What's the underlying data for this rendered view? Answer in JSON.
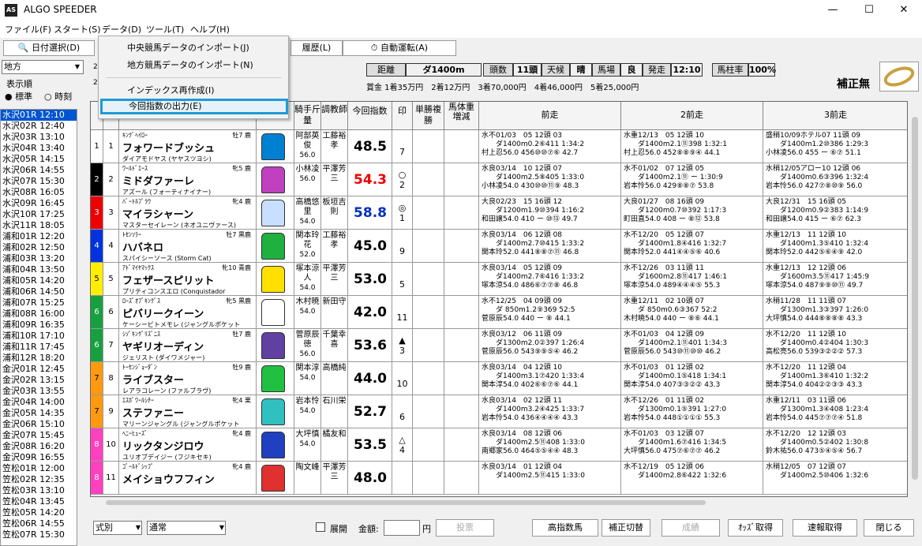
{
  "app": {
    "title": "ALGO SPEEDER",
    "logo": "AS"
  },
  "window": {
    "minimize": "—",
    "maximize": "☐",
    "close": "✕"
  },
  "menu": [
    "ファイル(F)",
    "スタート(S)",
    "データ(D)",
    "ツール(T)",
    "ヘルプ(H)"
  ],
  "toolbar": {
    "date_select": "日付選択(D)",
    "history": "履歴(L)",
    "auto_run": "自動運転(A)"
  },
  "dropdown": {
    "items": [
      "中央競馬データのインポート(J)",
      "地方競馬データのインポート(N)",
      "インデックス再作成(I)",
      "今回指数の出力(E)"
    ]
  },
  "left": {
    "venue": "地方",
    "sort_label": "表示順",
    "sort_standard": "● 標準",
    "sort_time": "○ 時刻"
  },
  "races": [
    "水沢01R 12:10",
    "水沢02R 12:40",
    "水沢03R 13:10",
    "水沢04R 13:40",
    "水沢05R 14:15",
    "水沢06R 14:55",
    "水沢07R 15:30",
    "水沢08R 16:05",
    "水沢09R 16:45",
    "水沢10R 17:25",
    "水沢11R 18:05",
    "浦和01R 12:20",
    "浦和02R 12:50",
    "浦和03R 13:20",
    "浦和04R 13:50",
    "浦和05R 14:20",
    "浦和06R 14:50",
    "浦和07R 15:25",
    "浦和08R 16:00",
    "浦和09R 16:35",
    "浦和10R 17:10",
    "浦和11R 17:45",
    "浦和12R 18:20",
    "金沢01R 12:45",
    "金沢02R 13:15",
    "金沢03R 13:55",
    "金沢04R 14:00",
    "金沢05R 14:35",
    "金沢06R 15:10",
    "金沢07R 15:45",
    "金沢08R 16:20",
    "金沢09R 16:55",
    "笠松01R 12:00",
    "笠松02R 12:35",
    "笠松03R 13:10",
    "笠松04R 13:45",
    "笠松05R 14:20",
    "笠松06R 14:55",
    "笠松07R 15:30"
  ],
  "race_info": {
    "dist_label": "距離",
    "dist": "ダ1400m",
    "heads_label": "頭数",
    "heads": "11頭",
    "weather_label": "天候",
    "weather": "晴",
    "track_label": "馬場",
    "track": "良",
    "post_label": "発走",
    "post": "12:10",
    "rate_label": "馬柱率",
    "rate": "100%",
    "prize": "賞金 1着35万円　2着12万円　3着70,000円　4着46,000円　5着25,000円",
    "correction": "補正無"
  },
  "headers": {
    "jockey": "騎手斤量",
    "trainer": "調教師",
    "index": "今回指数",
    "mark": "印",
    "odds": "単勝複勝",
    "weight": "馬体重増減",
    "p1": "前走",
    "p2": "2前走",
    "p3": "3前走"
  },
  "horses": [
    {
      "f": "1",
      "n": "1",
      "sire": "ｷﾝｸﾞﾍｲﾛｰ",
      "sex": "牡7 鹿",
      "name": "フォワードブッシュ",
      "dam": "ダイアモドヤス (ヤヤスツヨシ)",
      "j": "阿部英俊",
      "w": "56.0",
      "t": "工藤裕孝",
      "idx": "48.5",
      "ic": "#000",
      "mk": "",
      "pop": "7",
      "p": [
        "水不01/03　05 12頭 03",
        "ダ1400m0.2⑥411 1:34:2",
        "村上忍56.0 456⑩⑩⑦⑥ 42.7"
      ],
      "q": [
        "水重12/13　05 12頭 10",
        "ダ1400m2.1⑪398 1:32:1",
        "村上忍56.0 452⑧⑧⑨④ 44.1"
      ],
      "r": [
        "盛稍10/09ホテル07 11頭 09",
        "ダ1400m1.2⑩386 1:29:3",
        "小林凌56.0 455 ー ⑥⑦ 51.1"
      ]
    },
    {
      "f": "2",
      "n": "2",
      "sire": "ﾜｰﾙﾄﾞｴｰｽ",
      "sex": "牝5 鹿",
      "name": "ミドダファーレ",
      "dam": "アズール (フォーティナイナー)",
      "j": "小林凌",
      "w": "56.0",
      "t": "平澤芳三",
      "idx": "54.3",
      "ic": "#e00",
      "mk": "○",
      "pop": "2",
      "p": [
        "水良03/14　10 12頭 07",
        "ダ1400m2.5⑧405 1:33:0",
        "小林凌54.0 430⑩⑩⑪⑨ 48.3"
      ],
      "q": [
        "水不01/02　07 12頭 05",
        "ダ1400m2.1⑪ ー 1:30:9",
        "岩本怜56.0 429⑧⑧⑦ 53.8"
      ],
      "r": [
        "水稍12/05アロー10 12頭 06",
        "ダ1400m0.6③396 1:32:4",
        "岩本怜56.0 427⑦⑧⑩⑨ 56.0"
      ]
    },
    {
      "f": "3",
      "n": "3",
      "sire": "ﾊﾞｰﾄﾙﾌﾟﾗｳ",
      "sex": "牝4 鹿",
      "name": "マイラシャーン",
      "dam": "マスターセイレーン (ネオユニヴァース)",
      "j": "高橋悠里",
      "w": "54.0",
      "t": "板垣吉則",
      "idx": "58.8",
      "ic": "#0030c0",
      "mk": "◎",
      "pop": "1",
      "p": [
        "大良02/23　15 16頭 12",
        "ダ1200m1.9⑩394 1:16:2",
        "和田譲54.0 410 ー ⑩⑬ 49.7"
      ],
      "q": [
        "大良01/27　08 16頭 09",
        "ダ1200m0.7⑩392 1:17:3",
        "町田直54.0 408 ー ⑧⑫ 53.8"
      ],
      "r": [
        "大良12/31　15 16頭 05",
        "ダ1200m0.9②383 1:14:9",
        "和田譲54.0 415 ー ⑥⑦ 62.3"
      ]
    },
    {
      "f": "4",
      "n": "4",
      "sire": "ﾄｾﾝｿﾗｰ",
      "sex": "牡7 黒鹿",
      "name": "ハバネロ",
      "dam": "スパイシーソース (Storm Cat)",
      "j": "関本玲花",
      "w": "52.0",
      "t": "工藤裕孝",
      "idx": "45.0",
      "ic": "#000",
      "mk": "",
      "pop": "9",
      "p": [
        "水良03/14　06 12頭 08",
        "ダ1400m2.7⑩415 1:33:2",
        "関本玲52.0 441⑧⑧⑦⑪ 46.8"
      ],
      "q": [
        "水不12/20　05 12頭 07",
        "ダ1400m1.8④416 1:32:7",
        "関本玲52.0 441④④⑤⑥ 40.6"
      ],
      "r": [
        "水重12/13　11 12頭 10",
        "ダ1400m1.3⑤410 1:32:4",
        "関本玲52.0 442⑤⑥④⑨ 42.0"
      ]
    },
    {
      "f": "5",
      "n": "5",
      "sire": "ｱﾄﾞﾏｲﾔﾏｯｸｽ",
      "sex": "牝10 青鹿",
      "name": "フェザースピリット",
      "dam": "プリティコンスエロ (Conquistador",
      "j": "塚本涼人",
      "w": "54.0",
      "t": "平澤芳三",
      "idx": "53.0",
      "ic": "#000",
      "mk": "",
      "pop": "5",
      "p": [
        "水良03/14　05 12頭 09",
        "ダ1400m2.7⑥416 1:33:2",
        "塚本涼54.0 486⑥⑦⑦⑧ 46.8"
      ],
      "q": [
        "水不12/26　03 11頭 11",
        "ダ1600m2.8⑪417 1:46:1",
        "塚本涼54.0 489④④④⑤ 55.3"
      ],
      "r": [
        "水重12/13　12 12頭 06",
        "ダ1600m3.5⑪417 1:45:9",
        "塚本涼54.0 487⑨⑨⑩⑪ 49.7"
      ]
    },
    {
      "f": "6",
      "n": "6",
      "sire": "ﾛｰｽﾞｵﾌﾞｷﾝｸﾞｽ",
      "sex": "牝5 黒鹿",
      "name": "ピバリークイーン",
      "dam": "ケーシービトメモレ (ジャングルポケット",
      "j": "木村暁",
      "w": "54.0",
      "t": "新田守",
      "idx": "42.0",
      "ic": "#000",
      "mk": "",
      "pop": "11",
      "p": [
        "水不12/25　04 09頭 09",
        "ダ 850m1.2⑨369 52:5",
        "菅原辰54.0 440 ー ⑧ 44.1"
      ],
      "q": [
        "水重12/11　02 10頭 07",
        "ダ 850m0.6③367 52:2",
        "木村暁54.0 440 ー ⑧⑥ 44.1"
      ],
      "r": [
        "水稍11/28　11 11頭 07",
        "ダ1300m1.3③397 1:26:0",
        "大坪慎54.0 444⑧⑧⑧⑧ 43.3"
      ]
    },
    {
      "f": "6",
      "n": "7",
      "sire": "ｼｿﾞｷﾝｸﾞﾘｽﾞﾆｽ",
      "sex": "牡7 鹿",
      "name": "ヤギリオーディン",
      "dam": "ジェリスト (ダイワメジャー)",
      "j": "菅原辰徳",
      "w": "56.0",
      "t": "千葉幸喜",
      "idx": "53.6",
      "ic": "#000",
      "mk": "▲",
      "pop": "3",
      "p": [
        "水良03/12　06 11頭 09",
        "ダ1300m2.0②397 1:26:4",
        "菅原辰56.0 543⑨⑨⑤④ 46.2"
      ],
      "q": [
        "水不01/03　04 12頭 09",
        "ダ1400m2.1⑪401 1:34:3",
        "菅原辰56.0 543⑩⑪⑩⑩ 46.2"
      ],
      "r": [
        "水不12/20　11 12頭 10",
        "ダ1400m0.4②404 1:30:3",
        "高松亮56.0 539③②②② 57.3"
      ]
    },
    {
      "f": "7",
      "n": "8",
      "sire": "ﾄｰｾﾝｼﾞｮｰﾀﾞﾝ",
      "sex": "牡9 鹿",
      "name": "ライブスター",
      "dam": "レアラコレーン (ファルブラヴ)",
      "j": "関本淳",
      "w": "54.0",
      "t": "高橋純",
      "idx": "44.0",
      "ic": "#000",
      "mk": "",
      "pop": "10",
      "p": [
        "水良03/14　04 12頭 10",
        "ダ1400m3.1⑦420 1:33:4",
        "関本淳54.0 402⑥⑥⑦⑥ 44.1"
      ],
      "q": [
        "水不01/03　01 12頭 02",
        "ダ1400m0.1⑤418 1:34:1",
        "関本淳54.0 407③③②② 43.3"
      ],
      "r": [
        "水不12/20　11 12頭 04",
        "ダ1400m1.3⑥410 1:32:2",
        "関本淳54.0 404②②③③ 43.3"
      ]
    },
    {
      "f": "7",
      "n": "9",
      "sire": "ｴｽﾎﾟﾜｰﾙｼﾁｰ",
      "sex": "牝4 栗",
      "name": "ステファニー",
      "dam": "マリーンジャングル (ジャングルポケット",
      "j": "岩本怜",
      "w": "54.0",
      "t": "石川栄",
      "idx": "52.7",
      "ic": "#000",
      "mk": "",
      "pop": "6",
      "p": [
        "水良03/14　02 12頭 11",
        "ダ1400m3.2④425 1:33:7",
        "岩本怜54.0 436④④④④ 43.3"
      ],
      "q": [
        "水不12/26　01 11頭 02",
        "ダ1300m0.1⑤391 1:27:0",
        "岩本怜54.0 448①①①① 55.3"
      ],
      "r": [
        "水重12/11　03 11頭 06",
        "ダ1300m1.3④408 1:23:4",
        "岩本怜54.0 445⑦⑦⑦④ 51.8"
      ]
    },
    {
      "f": "8",
      "n": "10",
      "sire": "ﾍﾆｰﾋｭｰｽﾞ",
      "sex": "牝4 鹿",
      "name": "リックタンジロウ",
      "dam": "ユリオブデイジー (フジキセキ)",
      "j": "大坪慎",
      "w": "54.0",
      "t": "橘友和",
      "idx": "53.5",
      "ic": "#000",
      "mk": "△",
      "pop": "4",
      "p": [
        "水良03/14　08 12頭 06",
        "ダ1400m2.5⑪408 1:33:0",
        "南郷家56.0 464⑤⑤④④ 48.3"
      ],
      "q": [
        "水不01/03　03 12頭 07",
        "ダ1400m1.6⑦416 1:34:5",
        "大坪慎56.0 475⑦⑥⑦⑦ 46.2"
      ],
      "r": [
        "水不12/20　12 12頭 03",
        "ダ1400m0.5②402 1:30:8",
        "鈴木祐56.0 473⑤④⑤④ 56.7"
      ]
    },
    {
      "f": "8",
      "n": "11",
      "sire": "ｺﾞｰﾙﾄﾞｼｯﾌﾟ",
      "sex": "牝4 鹿",
      "name": "メイショウフフィン",
      "dam": "",
      "j": "陶文峰",
      "w": "",
      "t": "平澤芳三",
      "idx": "48.0",
      "ic": "#000",
      "mk": "",
      "pop": "",
      "p": [
        "水良03/14　01 12頭 04",
        "ダ1400m2.5⑪415 1:33:0",
        ""
      ],
      "q": [
        "水不12/19　05 12頭 06",
        "ダ1400m2.8⑥422 1:32:6",
        ""
      ],
      "r": [
        "水稍12/05　07 12頭 07",
        "ダ1400m2.5⑩406 1:32:6",
        ""
      ]
    }
  ],
  "bottom": {
    "type": "式別",
    "mode": "通常",
    "expand": "展開",
    "amount_label": "金額:",
    "yen": "円",
    "vote": "投票",
    "high_index": "高指数馬",
    "correction": "補正切替",
    "result": "成績",
    "odds": "ｵｯｽﾞ取得",
    "flash": "速報取得",
    "close": "閉じる"
  }
}
